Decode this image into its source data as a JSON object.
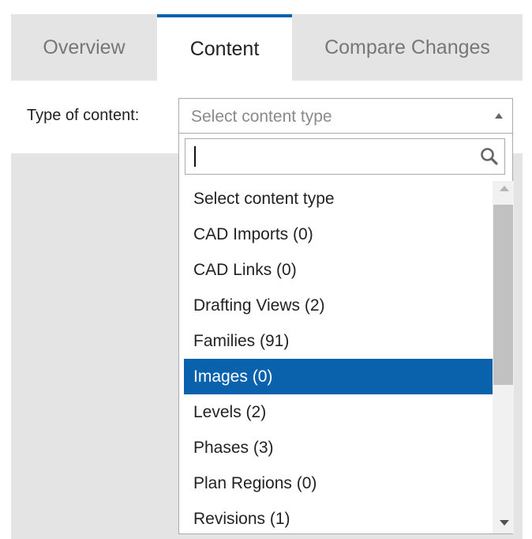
{
  "tabs": [
    {
      "label": "Overview"
    },
    {
      "label": "Content"
    },
    {
      "label": "Compare Changes"
    }
  ],
  "active_tab": "Content",
  "type_of_content": {
    "label": "Type of content:",
    "placeholder": "Select content type"
  },
  "dropdown": {
    "search_value": "",
    "options": [
      {
        "label": "Select content type"
      },
      {
        "label": "CAD Imports (0)"
      },
      {
        "label": "CAD Links (0)"
      },
      {
        "label": "Drafting Views (2)"
      },
      {
        "label": "Families (91)"
      },
      {
        "label": "Images (0)"
      },
      {
        "label": "Levels (2)"
      },
      {
        "label": "Phases (3)"
      },
      {
        "label": "Plan Regions (0)"
      },
      {
        "label": "Revisions (1)"
      }
    ],
    "highlighted_option": "Images (0)"
  },
  "icons": {
    "search": "search-icon",
    "select_arrow": "chevron-up-icon",
    "scroll_up": "scroll-up-icon",
    "scroll_down": "scroll-down-icon"
  },
  "colors": {
    "accent": "#0a62ad",
    "tab_bar": "#e4e4e4",
    "highlight_text": "#ffffff"
  }
}
